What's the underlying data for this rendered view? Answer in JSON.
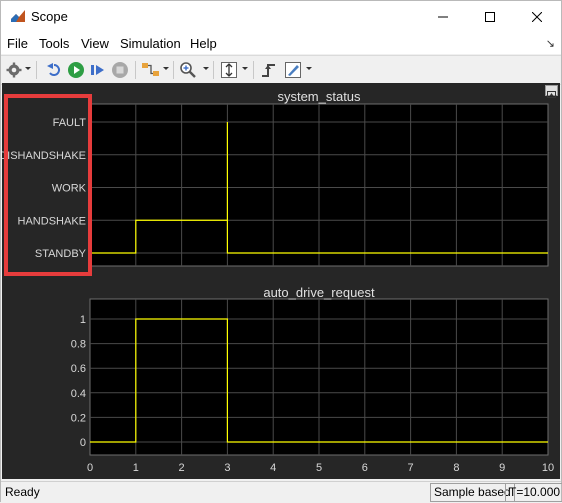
{
  "window": {
    "title": "Scope",
    "icons": {
      "app": "matlab-scope-icon",
      "minimize": "minimize-icon",
      "maximize": "maximize-icon",
      "close": "close-icon"
    }
  },
  "menu": {
    "items": [
      {
        "label": "File"
      },
      {
        "label": "Tools"
      },
      {
        "label": "View"
      },
      {
        "label": "Simulation"
      },
      {
        "label": "Help"
      }
    ]
  },
  "toolbar": {
    "icons": [
      "settings-gear-icon",
      "step-back-icon",
      "run-icon",
      "step-forward-icon",
      "stop-icon",
      "highlight-block-icon",
      "zoom-in-icon",
      "scale-axes-icon",
      "trigger-icon",
      "style-icon"
    ]
  },
  "plots": [
    {
      "title": "system_status",
      "ytick_labels": [
        "FAULT",
        "DISHANDSHAKE",
        "WORK",
        "HANDSHAKE",
        "STANDBY"
      ]
    },
    {
      "title": "auto_drive_request",
      "ytick_labels": [
        "1",
        "0.8",
        "0.6",
        "0.4",
        "0.2",
        "0"
      ]
    }
  ],
  "chart_data": [
    {
      "type": "line",
      "title": "system_status",
      "categories_y": [
        "STANDBY",
        "HANDSHAKE",
        "WORK",
        "DISHANDSHAKE",
        "FAULT"
      ],
      "xlim": [
        0,
        10
      ],
      "grid": true,
      "series": [
        {
          "color": "#ffff00",
          "x": [
            0,
            1,
            1,
            3,
            3,
            3,
            10
          ],
          "y": [
            "STANDBY",
            "STANDBY",
            "HANDSHAKE",
            "HANDSHAKE",
            "FAULT",
            "STANDBY",
            "STANDBY"
          ]
        }
      ]
    },
    {
      "type": "line",
      "title": "auto_drive_request",
      "xlim": [
        0,
        10
      ],
      "ylim": [
        0,
        1
      ],
      "grid": true,
      "xticks": [
        "0",
        "1",
        "2",
        "3",
        "4",
        "5",
        "6",
        "7",
        "8",
        "9",
        "10"
      ],
      "series": [
        {
          "color": "#ffff00",
          "x": [
            0,
            1,
            1,
            3,
            3,
            10
          ],
          "y": [
            0,
            0,
            1,
            1,
            0,
            0
          ]
        }
      ]
    }
  ],
  "status": {
    "left": "Ready",
    "mode": "Sample based",
    "time": "T=10.000"
  }
}
